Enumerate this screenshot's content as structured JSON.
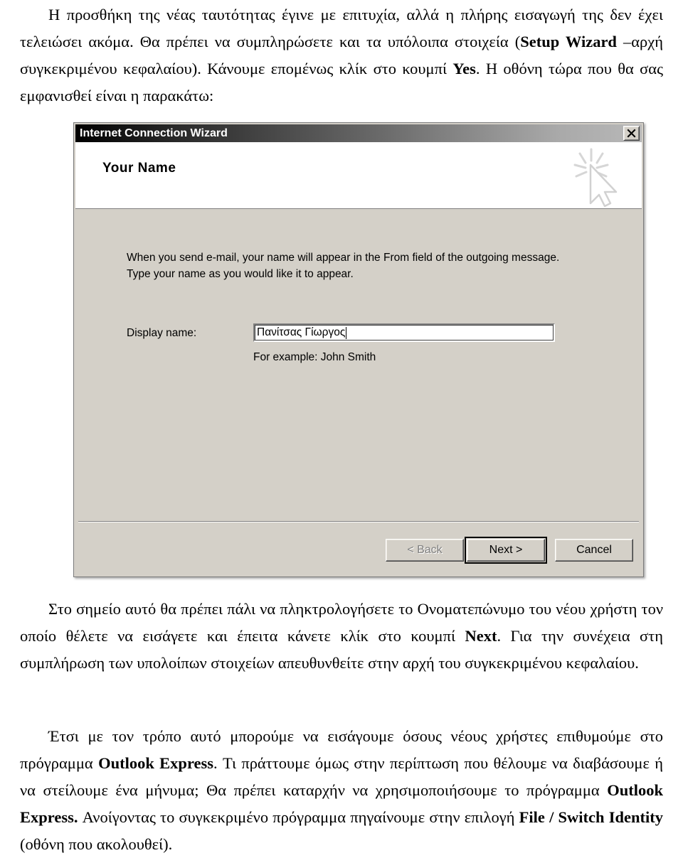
{
  "document": {
    "top_paragraph": {
      "segments": [
        {
          "text": "Η προσθήκη της νέας ταυτότητας έγινε με επιτυχία, αλλά η πλήρης εισαγωγή της δεν έχει τελειώσει ακόμα. Θα πρέπει να συμπληρώσετε και τα υπόλοιπα στοιχεία (",
          "style": "normal"
        },
        {
          "text": "Setup Wizard",
          "style": "bold"
        },
        {
          "text": " –αρχή συγκεκριμένου κεφαλαίου). Κάνουμε επομένως κλίκ στο κουμπί ",
          "style": "normal"
        },
        {
          "text": "Yes",
          "style": "bold"
        },
        {
          "text": ". Η οθόνη τώρα που θα σας εμφανισθεί είναι η παρακάτω:",
          "style": "normal"
        }
      ]
    },
    "middle_paragraph": {
      "segments": [
        {
          "text": "Στο σημείο αυτό θα πρέπει πάλι να πληκτρολογήσετε το Ονοματεπώνυμο του νέου χρήστη τον οποίο θέλετε να εισάγετε και έπειτα κάνετε κλίκ στο κουμπί ",
          "style": "normal"
        },
        {
          "text": "Next",
          "style": "bold"
        },
        {
          "text": ". Για την συνέχεια στη συμπλήρωση των υπολοίπων στοιχείων απευθυνθείτε στην αρχή του συγκεκριμένου κεφαλαίου.",
          "style": "normal"
        }
      ]
    },
    "bottom_paragraph": {
      "segments": [
        {
          "text": "Έτσι με τον τρόπο αυτό μπορούμε να εισάγουμε όσους νέους χρήστες επιθυμούμε στο πρόγραμμα ",
          "style": "normal"
        },
        {
          "text": "Outlook Express",
          "style": "bold"
        },
        {
          "text": ". Τι πράττουμε όμως στην περίπτωση που θέλουμε να διαβάσουμε ή να στείλουμε ένα μήνυμα; Θα πρέπει καταρχήν να χρησιμοποιήσουμε το πρόγραμμα ",
          "style": "normal"
        },
        {
          "text": "Outlook Express.",
          "style": "bold"
        },
        {
          "text": " Ανοίγοντας το συγκεκριμένο πρόγραμμα πηγαίνουμε στην επιλογή ",
          "style": "normal"
        },
        {
          "text": "File / Switch Identity",
          "style": "bold"
        },
        {
          "text": " (οθόνη που ακολουθεί).",
          "style": "normal"
        }
      ]
    }
  },
  "dialog": {
    "title": "Internet Connection Wizard",
    "close_button_label": "×",
    "header": {
      "heading": "Your Name",
      "graphic_name": "cursor-sparkle-watermark"
    },
    "instructions": {
      "line1": "When you send e-mail, your name will appear in the From field of the outgoing message.",
      "line2": "Type your name as you would like it to appear."
    },
    "display_name": {
      "label": "Display name:",
      "value": "Πανίτσας Γίωργος",
      "placeholder": "",
      "hint": "For example: John Smith"
    },
    "buttons": {
      "back": "< Back",
      "next": "Next >",
      "cancel": "Cancel"
    },
    "colors": {
      "face": "#d4d0c8",
      "titlebar_dark": "#000000",
      "titlebar_light": "#b8b8b8",
      "header_panel": "#ffffff",
      "disabled_text": "#808080"
    }
  }
}
